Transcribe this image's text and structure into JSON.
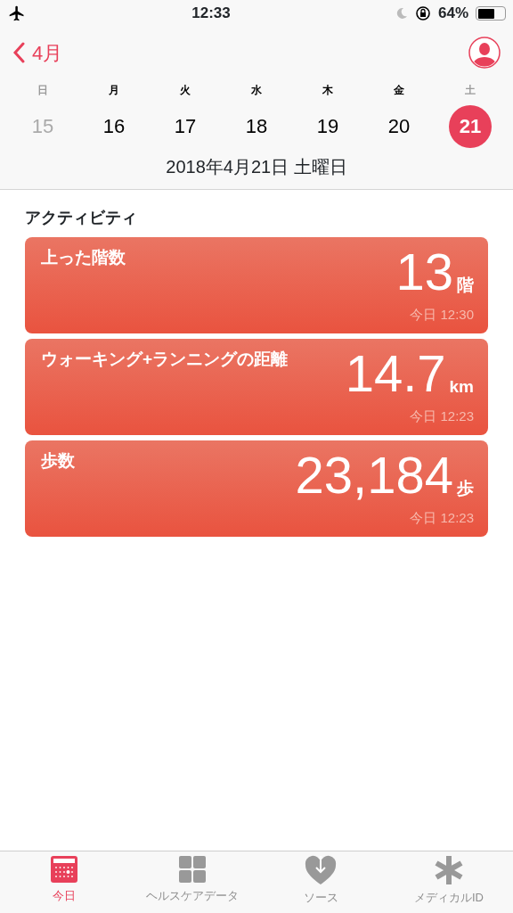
{
  "status_bar": {
    "time": "12:33",
    "battery": "64%"
  },
  "nav": {
    "back_label": "4月"
  },
  "week": [
    {
      "weekday": "日",
      "date": "15",
      "weekend": true,
      "selected": false
    },
    {
      "weekday": "月",
      "date": "16",
      "weekend": false,
      "selected": false
    },
    {
      "weekday": "火",
      "date": "17",
      "weekend": false,
      "selected": false
    },
    {
      "weekday": "水",
      "date": "18",
      "weekend": false,
      "selected": false
    },
    {
      "weekday": "木",
      "date": "19",
      "weekend": false,
      "selected": false
    },
    {
      "weekday": "金",
      "date": "20",
      "weekend": false,
      "selected": false
    },
    {
      "weekday": "土",
      "date": "21",
      "weekend": true,
      "selected": true
    }
  ],
  "full_date": "2018年4月21日 土曜日",
  "section_title": "アクティビティ",
  "cards": [
    {
      "title": "上った階数",
      "value": "13",
      "unit": "階",
      "time": "今日 12:30"
    },
    {
      "title": "ウォーキング+ランニングの距離",
      "value": "14.7",
      "unit": "km",
      "time": "今日 12:23"
    },
    {
      "title": "歩数",
      "value": "23,184",
      "unit": "歩",
      "time": "今日 12:23"
    }
  ],
  "tabs": [
    {
      "label": "今日",
      "kind": "calendar",
      "selected": true
    },
    {
      "label": "ヘルスケアデータ",
      "kind": "grid",
      "selected": false
    },
    {
      "label": "ソース",
      "kind": "heart",
      "selected": false
    },
    {
      "label": "メディカルID",
      "kind": "asterisk",
      "selected": false
    }
  ]
}
